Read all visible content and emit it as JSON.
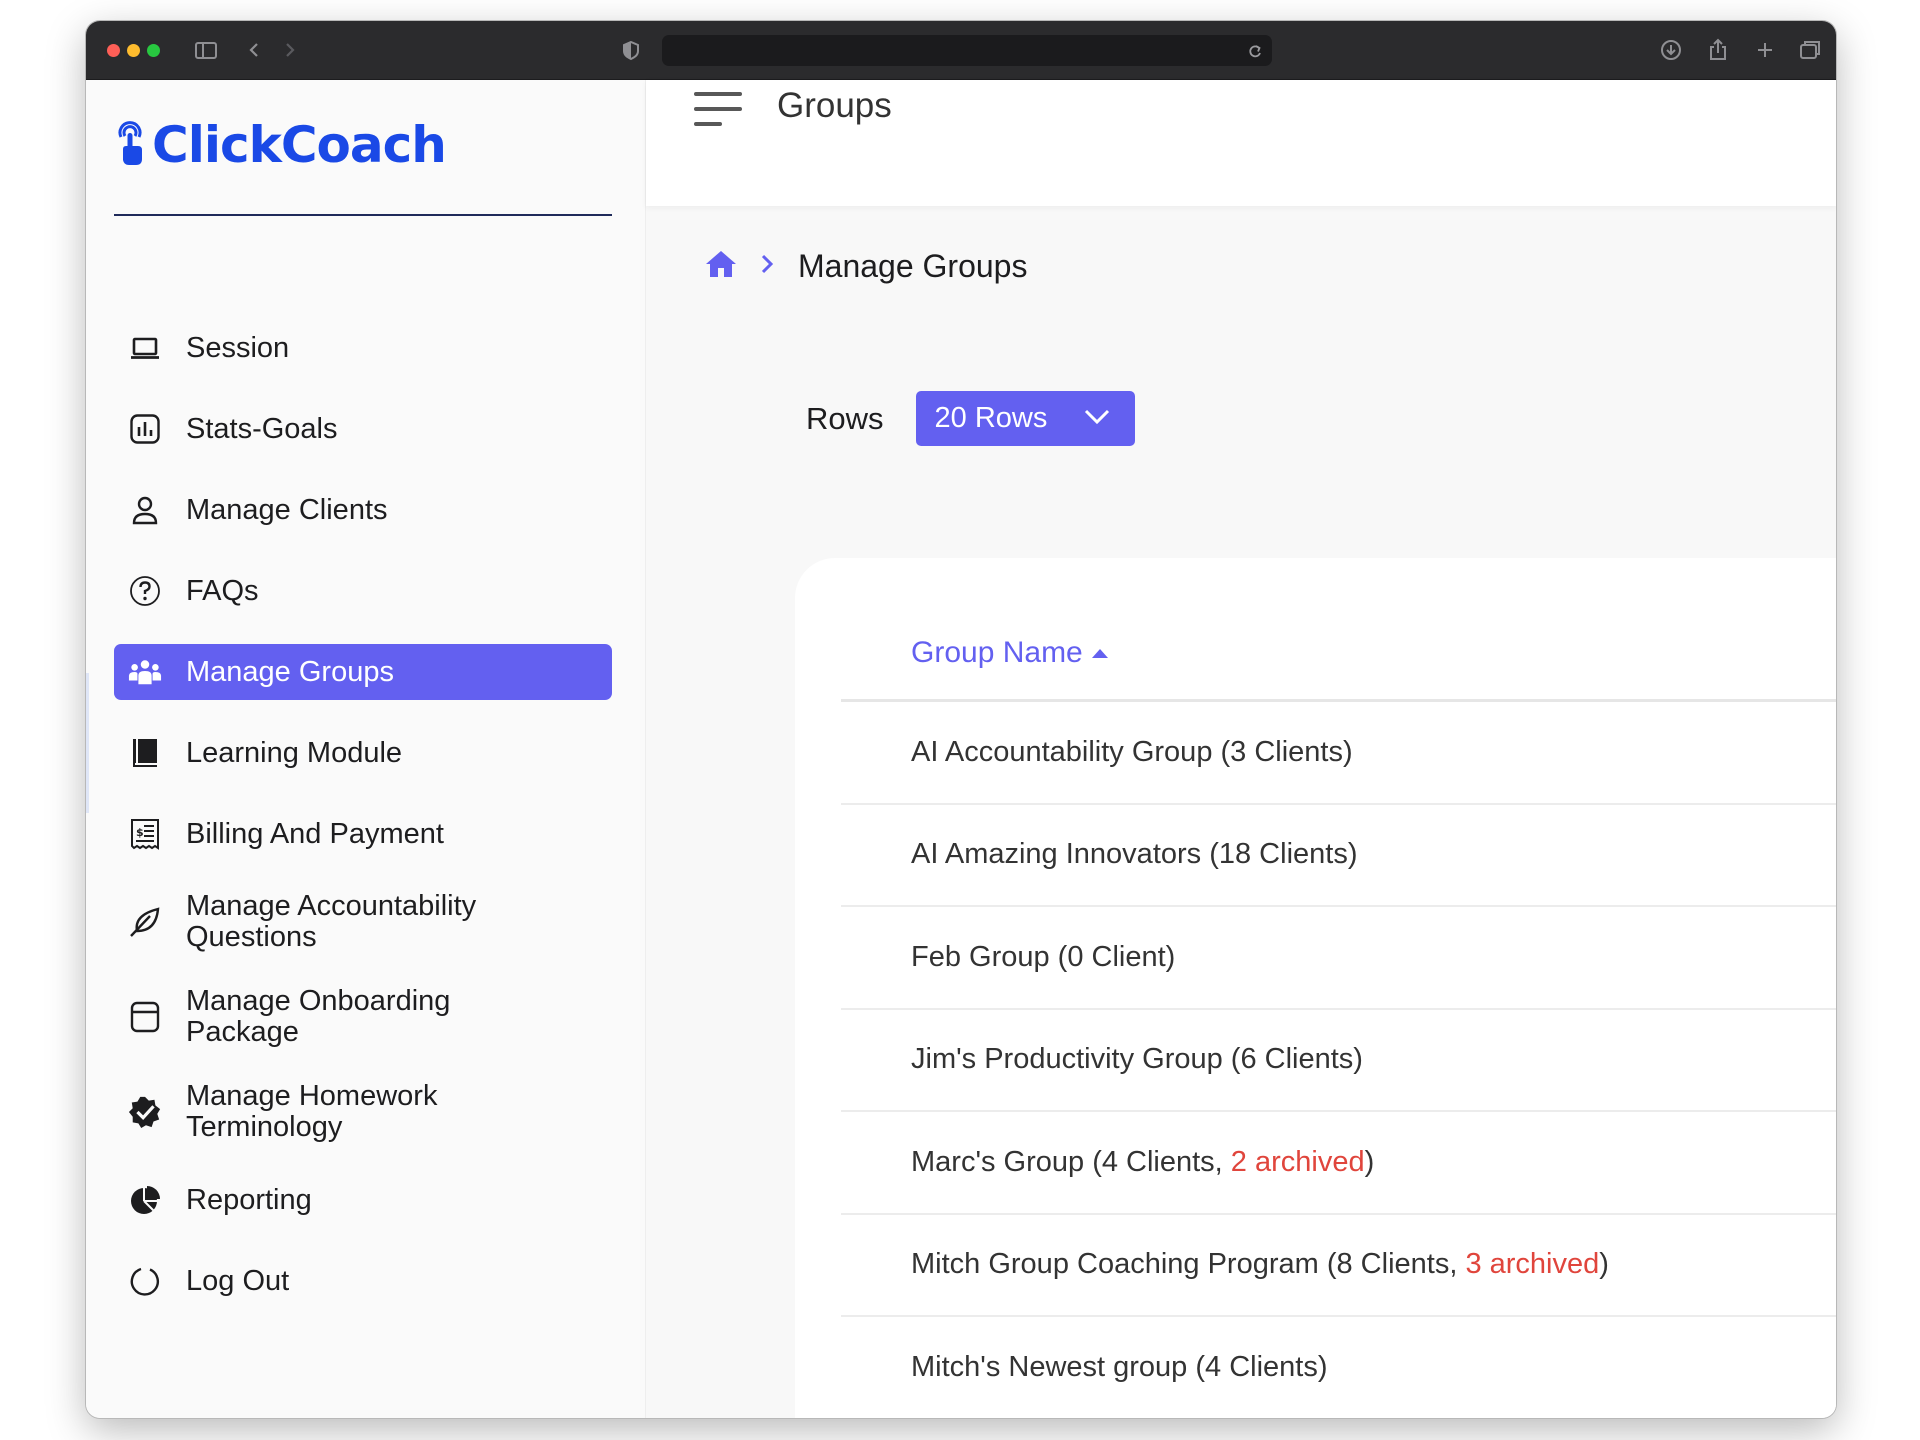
{
  "colors": {
    "accent": "#6360f0",
    "logo": "#1a49e6",
    "archived": "#e0453c",
    "traffic_red": "#fe5f57",
    "traffic_yellow": "#febc2e",
    "traffic_green": "#28c840"
  },
  "browser": {
    "icons": [
      "sidebar-toggle-icon",
      "back-icon",
      "forward-icon",
      "shield-icon",
      "reload-icon",
      "download-icon",
      "share-icon",
      "new-tab-icon",
      "tabs-overview-icon"
    ]
  },
  "logo": {
    "text": "ClickCoach"
  },
  "sidebar": {
    "items": [
      {
        "label": "Session",
        "icon": "laptop-icon"
      },
      {
        "label": "Stats-Goals",
        "icon": "bar-chart-icon"
      },
      {
        "label": "Manage Clients",
        "icon": "user-icon"
      },
      {
        "label": "FAQs",
        "icon": "question-icon"
      },
      {
        "label": "Manage Groups",
        "icon": "group-icon",
        "active": true
      },
      {
        "label": "Learning Module",
        "icon": "book-icon"
      },
      {
        "label": "Billing And Payment",
        "icon": "receipt-icon"
      },
      {
        "label": "Manage Accountability Questions",
        "icon": "leaf-icon"
      },
      {
        "label": "Manage Onboarding Package",
        "icon": "archive-icon"
      },
      {
        "label": "Manage Homework Terminology",
        "icon": "badge-check-icon"
      },
      {
        "label": "Reporting",
        "icon": "pie-chart-icon"
      },
      {
        "label": "Log Out",
        "icon": "logout-icon"
      }
    ]
  },
  "header": {
    "title": "Groups"
  },
  "breadcrumb": {
    "home_icon": "home-icon",
    "current": "Manage Groups"
  },
  "rows": {
    "label": "Rows",
    "selected": "20 Rows"
  },
  "table": {
    "column_header": "Group Name",
    "sort": "ascending",
    "groups": [
      {
        "name": "AI Accountability Group (3 Clients)"
      },
      {
        "name": "AI Amazing Innovators (18 Clients)"
      },
      {
        "name": "Feb Group (0 Client)"
      },
      {
        "name": "Jim's Productivity Group (6 Clients)"
      },
      {
        "name": "Marc's Group (4 Clients, ",
        "archived": "2 archived",
        "suffix": ")"
      },
      {
        "name": "Mitch Group Coaching Program (8 Clients, ",
        "archived": "3 archived",
        "suffix": ")"
      },
      {
        "name": "Mitch's Newest group (4 Clients)"
      }
    ]
  }
}
